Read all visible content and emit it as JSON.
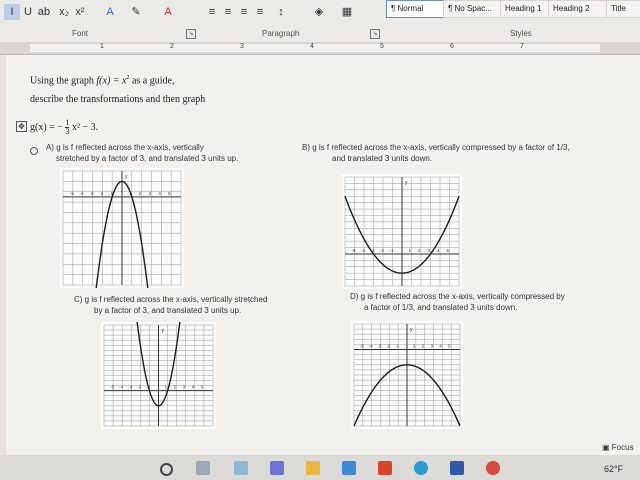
{
  "ribbon": {
    "format_buttons": [
      {
        "name": "italic-button",
        "label": "I"
      },
      {
        "name": "underline-button",
        "label": "U"
      },
      {
        "name": "strikethrough-button",
        "label": "ab"
      },
      {
        "name": "subscript-button",
        "label": "x₂"
      },
      {
        "name": "superscript-button",
        "label": "x²"
      },
      {
        "name": "text-effects-button",
        "label": "A"
      },
      {
        "name": "highlight-button",
        "label": "✎"
      },
      {
        "name": "font-color-button",
        "label": "A"
      }
    ],
    "groups": {
      "font": "Font",
      "paragraph": "Paragraph",
      "styles": "Styles"
    },
    "styles": [
      "¶ Normal",
      "¶ No Spac...",
      "Heading 1",
      "Heading 2",
      "Title"
    ],
    "active_style": "¶ Normal"
  },
  "ruler": {
    "numbers": [
      "1",
      "2",
      "3",
      "4",
      "5",
      "6",
      "7"
    ]
  },
  "document": {
    "line1_a": "Using the graph",
    "line1_fx": "f(x) = x",
    "line1_b": "as a guide,",
    "line2": "describe the transformations and then graph",
    "gx_label": "g(x) = −",
    "gx_frac_num": "1",
    "gx_frac_den": "3",
    "gx_rest": "x² − 3.",
    "options": {
      "A": {
        "line1": "A)  g is f reflected  across the x-axis, vertically",
        "line2": "stretched  by a factor of 3, and translated 3 units up."
      },
      "B": {
        "line1": "B) g is f reflected across the x-axis, vertically compressed by a factor of 1/3,",
        "line2": "and translated 3 units down."
      },
      "C": {
        "line1": "C)  g is f reflected across the x-axis, vertically stretched",
        "line2": "by a factor of 3, and translated 3 units up."
      },
      "D": {
        "line1": "D) g is f reflected across the x-axis, vertically compressed by",
        "line2": "a factor of 1/3, and translated 3 units down."
      }
    },
    "axis_label_y": "y",
    "x_ticks": [
      "-5",
      "-4",
      "-3",
      "-2",
      "-1",
      "1",
      "2",
      "3",
      "4",
      "5"
    ]
  },
  "status": {
    "focus": "Focus",
    "weather": "62°F"
  },
  "colors": {
    "curve": "#1c1c1c",
    "grid": "#9c9c9c",
    "ribbon": "#eceae7",
    "page": "#f2f1ee"
  }
}
